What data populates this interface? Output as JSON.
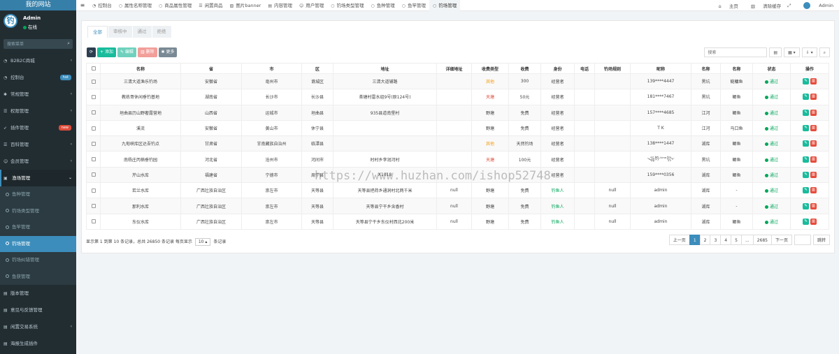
{
  "sidebar": {
    "logo": "我的网站",
    "avatar_glyph": "钓",
    "user_name": "Admin",
    "user_status": "在线",
    "search_placeholder": "搜索菜单",
    "menu": [
      {
        "label": "B2B2C商城",
        "icon": "dashboard-icon",
        "arrow": "‹",
        "badge": ""
      },
      {
        "label": "控制台",
        "icon": "dashboard-icon",
        "arrow": "",
        "badge": "hot",
        "badge_color": "#3c8dbc"
      },
      {
        "label": "常规管理",
        "icon": "cogs-icon",
        "arrow": "‹",
        "badge": ""
      },
      {
        "label": "权限管理",
        "icon": "group-icon",
        "arrow": "‹",
        "badge": ""
      },
      {
        "label": "插件管理",
        "icon": "rocket-icon",
        "arrow": "",
        "badge": "new",
        "badge_color": "#dd4b39"
      },
      {
        "label": "百科管理",
        "icon": "list-icon",
        "arrow": "‹",
        "badge": ""
      },
      {
        "label": "会员管理",
        "icon": "user-icon",
        "arrow": "‹",
        "badge": ""
      }
    ],
    "open_menu": {
      "label": "渔场管理",
      "arrow": "⌄"
    },
    "submenu": [
      "鱼种管理",
      "钓场类型管理",
      "鱼竿管理",
      "钓场管理",
      "钓场纠错管理",
      "鱼获管理"
    ],
    "submenu_active_index": 3,
    "menu_after": [
      {
        "label": "版本管理",
        "arrow": ""
      },
      {
        "label": "意见与反馈管理",
        "arrow": ""
      },
      {
        "label": "闲置交易系统",
        "arrow": "‹"
      },
      {
        "label": "海报生成插件",
        "arrow": ""
      }
    ]
  },
  "topbar": {
    "tabs": [
      {
        "label": "控制台",
        "icon": "dashboard-icon"
      },
      {
        "label": "属性名称管理",
        "icon": "circle-icon"
      },
      {
        "label": "商品属性管理",
        "icon": "circle-icon"
      },
      {
        "label": "闲置商品",
        "icon": "list-icon"
      },
      {
        "label": "图片banner",
        "icon": "image-icon"
      },
      {
        "label": "内容管理",
        "icon": "file-icon"
      },
      {
        "label": "用户管理",
        "icon": "user-icon"
      },
      {
        "label": "钓场类型管理",
        "icon": "circle-icon"
      },
      {
        "label": "鱼种管理",
        "icon": "circle-icon"
      },
      {
        "label": "鱼竿管理",
        "icon": "circle-icon"
      },
      {
        "label": "钓场管理",
        "icon": "circle-icon"
      }
    ],
    "active_tab_index": 10,
    "home": "主页",
    "clear_cache": "清除缓存",
    "admin": "Admin"
  },
  "status_tabs": [
    "全部",
    "审核中",
    "通过",
    "拒绝"
  ],
  "toolbar": {
    "refresh": "",
    "add": "添加",
    "edit": "编辑",
    "delete": "删除",
    "more": "更多",
    "search_placeholder": "搜索"
  },
  "table": {
    "columns": [
      "名称",
      "省",
      "市",
      "区",
      "地址",
      "详细地址",
      "收费类型",
      "收费",
      "身份",
      "电话",
      "钓场规则",
      "昵称",
      "名称",
      "名称",
      "状态",
      "操作"
    ],
    "rows": [
      [
        "三清大道渔乐钓场",
        "安徽省",
        "亳州市",
        "谯城区",
        "三清大道辅路",
        "",
        "其他",
        "300",
        "经营者",
        "",
        "",
        "139****4447",
        "黑坑",
        "鲢鳙鱼",
        "通过"
      ],
      [
        "教练哥休闲垂钓基地",
        "湖南省",
        "长沙市",
        "长沙县",
        "茶塘村雷水组9号(原124号)",
        "",
        "天塘",
        "50元",
        "经营者",
        "",
        "",
        "181****7467",
        "黑坑",
        "鲫鱼",
        "通过"
      ],
      [
        "垣曲县历山野奢露营地",
        "山西省",
        "运城市",
        "垣曲县",
        "935县道南堡村",
        "",
        "野塘",
        "免费",
        "经营者",
        "",
        "",
        "157****4685",
        "江河",
        "鲫鱼",
        "通过"
      ],
      [
        "溪流",
        "安徽省",
        "黄山市",
        "休宁县",
        "",
        "",
        "野塘",
        "免费",
        "经营者",
        "",
        "",
        "T K",
        "江河",
        "马口鱼",
        "通过"
      ],
      [
        "九甸峡库区达吾钓点",
        "甘肃省",
        "甘南藏族自治州",
        "临潭县",
        "",
        "",
        "其他",
        "天然钓场",
        "经营者",
        "",
        "",
        "138****1447",
        "湖库",
        "鲫鱼",
        "通过"
      ],
      [
        "南杨庄丙楠垂钓园",
        "河北省",
        "沧州市",
        "河间市",
        "时村乡李润河村",
        "",
        "天塘",
        "100元",
        "经营者",
        "",
        "",
        "·꧁钓·ᵗⁱᵐᵉ꧂·",
        "黑坑",
        "鲫鱼",
        "通过"
      ],
      [
        "芹山水库",
        "福建省",
        "宁德市",
        "周宁县",
        "X1018",
        "",
        "",
        "",
        "经营者",
        "",
        "",
        "159****0356",
        "湖库",
        "鲫鱼",
        "通过"
      ],
      [
        "若兰水库",
        "广西壮族自治区",
        "崇左市",
        "天等县",
        "天等县把荷乡通洞村北两千米",
        "null",
        "野塘",
        "免费",
        "钓鱼人",
        "",
        "null",
        "admin",
        "湖库",
        "-",
        "通过"
      ],
      [
        "那利水库",
        "广西壮族自治区",
        "崇左市",
        "天等县",
        "天等县宁干乡含香村",
        "null",
        "野塘",
        "免费",
        "钓鱼人",
        "",
        "null",
        "admin",
        "湖库",
        "-",
        "通过"
      ],
      [
        "东仪水库",
        "广西壮族自治区",
        "崇左市",
        "天等县",
        "天等县宁干乡东仪村西北200米",
        "null",
        "野塘",
        "免费",
        "钓鱼人",
        "",
        "null",
        "admin",
        "湖库",
        "鲫鱼",
        "通过"
      ]
    ]
  },
  "pagination": {
    "info_prefix": "显示第 1 到第 10 条记录，总共 26850 条记录 每页显示",
    "page_size": "10",
    "info_suffix": "条记录",
    "prev": "上一页",
    "pages": [
      "1",
      "2",
      "3",
      "4",
      "5",
      "...",
      "2685"
    ],
    "active_page": "1",
    "next": "下一页",
    "jump": "跳转"
  },
  "watermark": "https://www.huzhan.com/ishop52748",
  "colors": {
    "sidebar_bg": "#222d32",
    "accent": "#3c8dbc",
    "add": "#18bc9c",
    "edit": "#6fd1bd",
    "delete": "#f29e99",
    "more": "#7a8a95",
    "refresh": "#2c3e50",
    "approved": "#00a65a",
    "edit_row": "#18bc9c",
    "delete_row": "#e74c3c"
  }
}
